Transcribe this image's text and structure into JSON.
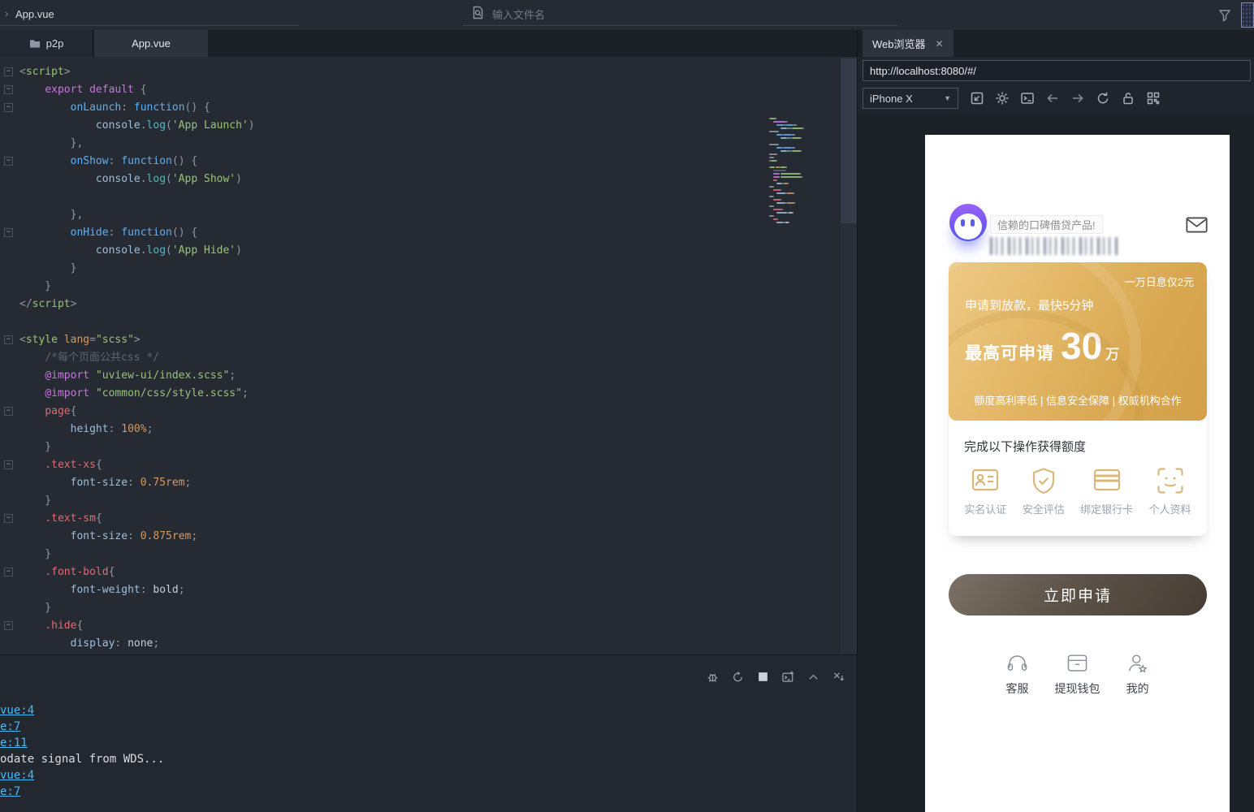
{
  "topbar": {
    "breadcrumb": "App.vue",
    "search_placeholder": "输入文件名"
  },
  "tabs": {
    "project": "p2p",
    "file": "App.vue"
  },
  "code": {
    "token_colors": {
      "p": "#8f97a3",
      "tag": "#98c379",
      "attr": "#d19a66",
      "kw": "#c678dd",
      "id": "#61afef",
      "obj": "#9cbfdb",
      "fn": "#56b6c2",
      "str": "#98c379",
      "sel": "#e06c75",
      "prop": "#9cbfdb",
      "num": "#d19a66",
      "val": "#c8ccd4",
      "com": "#5c6773"
    },
    "lines": [
      {
        "fold": true,
        "tokens": [
          [
            "p",
            "<"
          ],
          [
            "tag",
            "script"
          ],
          [
            "p",
            ">"
          ]
        ]
      },
      {
        "fold": true,
        "tokens": [
          [
            "p",
            "    "
          ],
          [
            "kw",
            "export default"
          ],
          [
            "p",
            " {"
          ]
        ]
      },
      {
        "fold": true,
        "tokens": [
          [
            "p",
            "        "
          ],
          [
            "id",
            "onLaunch"
          ],
          [
            "p",
            ": "
          ],
          [
            "id",
            "function"
          ],
          [
            "p",
            "() {"
          ]
        ]
      },
      {
        "fold": false,
        "tokens": [
          [
            "p",
            "            "
          ],
          [
            "obj",
            "console"
          ],
          [
            "p",
            "."
          ],
          [
            "fn",
            "log"
          ],
          [
            "p",
            "("
          ],
          [
            "str",
            "'App Launch'"
          ],
          [
            "p",
            ")"
          ]
        ]
      },
      {
        "fold": false,
        "tokens": [
          [
            "p",
            "        },"
          ]
        ]
      },
      {
        "fold": true,
        "tokens": [
          [
            "p",
            "        "
          ],
          [
            "id",
            "onShow"
          ],
          [
            "p",
            ": "
          ],
          [
            "id",
            "function"
          ],
          [
            "p",
            "() {"
          ]
        ]
      },
      {
        "fold": false,
        "tokens": [
          [
            "p",
            "            "
          ],
          [
            "obj",
            "console"
          ],
          [
            "p",
            "."
          ],
          [
            "fn",
            "log"
          ],
          [
            "p",
            "("
          ],
          [
            "str",
            "'App Show'"
          ],
          [
            "p",
            ")"
          ]
        ]
      },
      {
        "fold": false,
        "tokens": []
      },
      {
        "fold": false,
        "tokens": [
          [
            "p",
            "        },"
          ]
        ]
      },
      {
        "fold": true,
        "tokens": [
          [
            "p",
            "        "
          ],
          [
            "id",
            "onHide"
          ],
          [
            "p",
            ": "
          ],
          [
            "id",
            "function"
          ],
          [
            "p",
            "() {"
          ]
        ]
      },
      {
        "fold": false,
        "tokens": [
          [
            "p",
            "            "
          ],
          [
            "obj",
            "console"
          ],
          [
            "p",
            "."
          ],
          [
            "fn",
            "log"
          ],
          [
            "p",
            "("
          ],
          [
            "str",
            "'App Hide'"
          ],
          [
            "p",
            ")"
          ]
        ]
      },
      {
        "fold": false,
        "tokens": [
          [
            "p",
            "        }"
          ]
        ]
      },
      {
        "fold": false,
        "tokens": [
          [
            "p",
            "    }"
          ]
        ]
      },
      {
        "fold": false,
        "tokens": [
          [
            "p",
            "</"
          ],
          [
            "tag",
            "script"
          ],
          [
            "p",
            ">"
          ]
        ]
      },
      {
        "fold": false,
        "tokens": []
      },
      {
        "fold": true,
        "tokens": [
          [
            "p",
            "<"
          ],
          [
            "tag",
            "style"
          ],
          [
            "p",
            " "
          ],
          [
            "attr",
            "lang"
          ],
          [
            "p",
            "="
          ],
          [
            "str",
            "\"scss\""
          ],
          [
            "p",
            ">"
          ]
        ]
      },
      {
        "fold": false,
        "tokens": [
          [
            "p",
            "    "
          ],
          [
            "com",
            "/*每个页面公共css */"
          ]
        ]
      },
      {
        "fold": false,
        "tokens": [
          [
            "p",
            "    "
          ],
          [
            "kw",
            "@import"
          ],
          [
            "p",
            " "
          ],
          [
            "str",
            "\"uview-ui/index.scss\""
          ],
          [
            "p",
            ";"
          ]
        ]
      },
      {
        "fold": false,
        "tokens": [
          [
            "p",
            "    "
          ],
          [
            "kw",
            "@import"
          ],
          [
            "p",
            " "
          ],
          [
            "str",
            "\"common/css/style.scss\""
          ],
          [
            "p",
            ";"
          ]
        ]
      },
      {
        "fold": true,
        "tokens": [
          [
            "p",
            "    "
          ],
          [
            "sel",
            "page"
          ],
          [
            "p",
            "{"
          ]
        ]
      },
      {
        "fold": false,
        "tokens": [
          [
            "p",
            "        "
          ],
          [
            "prop",
            "height"
          ],
          [
            "p",
            ": "
          ],
          [
            "num",
            "100%"
          ],
          [
            "p",
            ";"
          ]
        ]
      },
      {
        "fold": false,
        "tokens": [
          [
            "p",
            "    }"
          ]
        ]
      },
      {
        "fold": true,
        "tokens": [
          [
            "p",
            "    "
          ],
          [
            "sel",
            ".text-xs"
          ],
          [
            "p",
            "{"
          ]
        ]
      },
      {
        "fold": false,
        "tokens": [
          [
            "p",
            "        "
          ],
          [
            "prop",
            "font-size"
          ],
          [
            "p",
            ": "
          ],
          [
            "num",
            "0.75rem"
          ],
          [
            "p",
            ";"
          ]
        ]
      },
      {
        "fold": false,
        "tokens": [
          [
            "p",
            "    }"
          ]
        ]
      },
      {
        "fold": true,
        "tokens": [
          [
            "p",
            "    "
          ],
          [
            "sel",
            ".text-sm"
          ],
          [
            "p",
            "{"
          ]
        ]
      },
      {
        "fold": false,
        "tokens": [
          [
            "p",
            "        "
          ],
          [
            "prop",
            "font-size"
          ],
          [
            "p",
            ": "
          ],
          [
            "num",
            "0.875rem"
          ],
          [
            "p",
            ";"
          ]
        ]
      },
      {
        "fold": false,
        "tokens": [
          [
            "p",
            "    }"
          ]
        ]
      },
      {
        "fold": true,
        "tokens": [
          [
            "p",
            "    "
          ],
          [
            "sel",
            ".font-bold"
          ],
          [
            "p",
            "{"
          ]
        ]
      },
      {
        "fold": false,
        "tokens": [
          [
            "p",
            "        "
          ],
          [
            "prop",
            "font-weight"
          ],
          [
            "p",
            ": "
          ],
          [
            "val",
            "bold"
          ],
          [
            "p",
            ";"
          ]
        ]
      },
      {
        "fold": false,
        "tokens": [
          [
            "p",
            "    }"
          ]
        ]
      },
      {
        "fold": true,
        "tokens": [
          [
            "p",
            "    "
          ],
          [
            "sel",
            ".hide"
          ],
          [
            "p",
            "{"
          ]
        ]
      },
      {
        "fold": false,
        "tokens": [
          [
            "p",
            "        "
          ],
          [
            "prop",
            "display"
          ],
          [
            "p",
            ": "
          ],
          [
            "val",
            "none"
          ],
          [
            "p",
            ";"
          ]
        ]
      }
    ]
  },
  "console": {
    "toolbar_icons": [
      "debug",
      "restart",
      "stop",
      "new-terminal",
      "collapse",
      "close"
    ],
    "lines": [
      {
        "text": "vue:4",
        "link": true
      },
      {
        "text": "e:7",
        "link": true
      },
      {
        "text": "e:11",
        "link": true
      },
      {
        "text": "odate signal from WDS...",
        "link": false
      },
      {
        "text": "vue:4",
        "link": true
      },
      {
        "text": "e:7",
        "link": true
      }
    ]
  },
  "browser": {
    "tab": "Web浏览器",
    "close_glyph": "✕",
    "url": "http://localhost:8080/#/",
    "device": "iPhone X",
    "toolbar_icons": [
      "open-external",
      "settings",
      "terminal",
      "back",
      "forward",
      "refresh",
      "lock",
      "qr-grid"
    ]
  },
  "app": {
    "slogan": "信赖的口碑借贷产品!",
    "banner": {
      "tag": "一万日息仅2元",
      "subtitle": "申请到放款，最快5分钟",
      "amount_prefix": "最高可申请",
      "amount": "30",
      "amount_unit": "万",
      "features": "额度高利率低 | 信息安全保障 | 权威机构合作"
    },
    "tasks": {
      "title": "完成以下操作获得额度",
      "items": [
        {
          "icon": "id-card-icon",
          "label": "实名认证"
        },
        {
          "icon": "shield-check-icon",
          "label": "安全评估"
        },
        {
          "icon": "bank-card-icon",
          "label": "绑定银行卡"
        },
        {
          "icon": "face-scan-icon",
          "label": "个人资料"
        }
      ]
    },
    "apply_button": "立即申请",
    "nav": [
      {
        "icon": "headset-icon",
        "label": "客服"
      },
      {
        "icon": "wallet-icon",
        "label": "提现钱包"
      },
      {
        "icon": "user-star-icon",
        "label": "我的"
      }
    ]
  }
}
